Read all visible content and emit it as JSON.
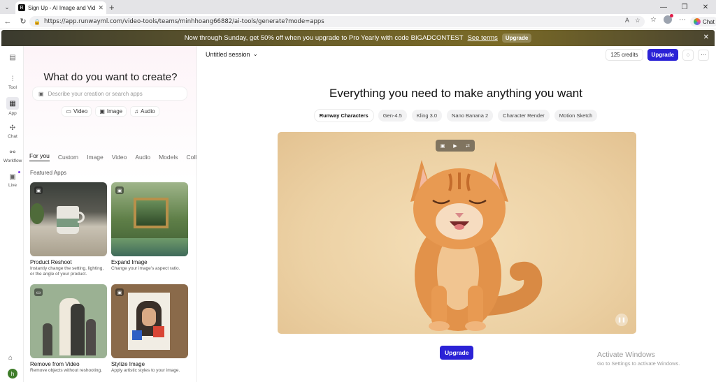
{
  "browser": {
    "tab_title": "Sign Up - AI Image and Video Gen",
    "url": "https://app.runwayml.com/video-tools/teams/minhhoang66882/ai-tools/generate?mode=apps",
    "chat_label": "Chat"
  },
  "promo": {
    "text": "Now through Sunday, get 50% off when you upgrade to Pro Yearly with code BIGADCONTEST",
    "link": "See terms",
    "button": "Upgrade"
  },
  "rail": {
    "items": [
      {
        "label": "",
        "icon": "layout-icon"
      },
      {
        "label": "Tool",
        "icon": "sliders-icon"
      },
      {
        "label": "App",
        "icon": "grid-icon"
      },
      {
        "label": "Chat",
        "icon": "sparkle-icon"
      },
      {
        "label": "Workflow",
        "icon": "workflow-icon"
      },
      {
        "label": "Live",
        "icon": "live-icon"
      }
    ],
    "avatar_initial": "h"
  },
  "left": {
    "title": "What do you want to create?",
    "search_placeholder": "Describe your creation or search apps",
    "chips": [
      "Video",
      "Image",
      "Audio"
    ],
    "tabs": [
      "For you",
      "Custom",
      "Image",
      "Video",
      "Audio",
      "Models",
      "Collecti"
    ],
    "section": "Featured Apps",
    "cards": [
      {
        "title": "Product Reshoot",
        "desc": "Instantly change the setting, lighting, or the angle of your product."
      },
      {
        "title": "Expand Image",
        "desc": "Change your image's aspect ratio."
      },
      {
        "title": "Remove from Video",
        "desc": "Remove objects without reshooting."
      },
      {
        "title": "Stylize Image",
        "desc": "Apply artistic styles to your image."
      }
    ]
  },
  "main": {
    "session": "Untitled session",
    "credits": "125 credits",
    "upgrade": "Upgrade",
    "headline": "Everything you need to make anything you want",
    "model_tabs": [
      "Runway Characters",
      "Gen-4.5",
      "Kling 3.0",
      "Nano Banana 2",
      "Character Render",
      "Motion Sketch"
    ],
    "upgrade_bottom": "Upgrade"
  },
  "watermark": {
    "line1": "Activate Windows",
    "line2": "Go to Settings to activate Windows."
  }
}
